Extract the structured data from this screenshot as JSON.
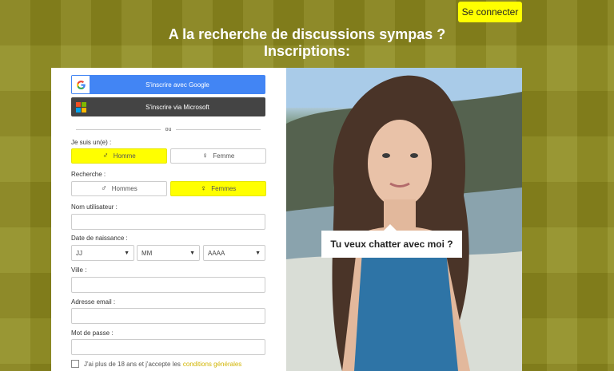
{
  "header": {
    "login_label": "Se connecter",
    "headline_line1": "A la recherche de discussions sympas ?",
    "headline_line2": "Inscriptions:"
  },
  "sso": {
    "google_label": "S'inscrire avec Google",
    "microsoft_label": "S'inscrire via Microsoft",
    "divider": "ou"
  },
  "form": {
    "gender_label": "Je suis un(e) :",
    "gender_options": [
      "Homme",
      "Femme"
    ],
    "gender_selected": "Homme",
    "seeking_label": "Recherche :",
    "seeking_options": [
      "Hommes",
      "Femmes"
    ],
    "seeking_selected": "Femmes",
    "username_label": "Nom utilisateur :",
    "username_value": "",
    "dob_label": "Date de naissance :",
    "dob_day": "JJ",
    "dob_month": "MM",
    "dob_year": "AAAA",
    "city_label": "Ville :",
    "city_value": "",
    "email_label": "Adresse email :",
    "email_value": "",
    "password_label": "Mot de passe :",
    "password_value": "",
    "tos_text": "J'ai plus de 18 ans et j'accepte les",
    "tos_link": "conditions générales"
  },
  "photo": {
    "bubble_text": "Tu veux chatter avec moi ?"
  },
  "colors": {
    "accent": "#ffff00",
    "google_blue": "#4285f4",
    "microsoft_dark": "#444444",
    "page_bg": "#8f8b1e"
  }
}
